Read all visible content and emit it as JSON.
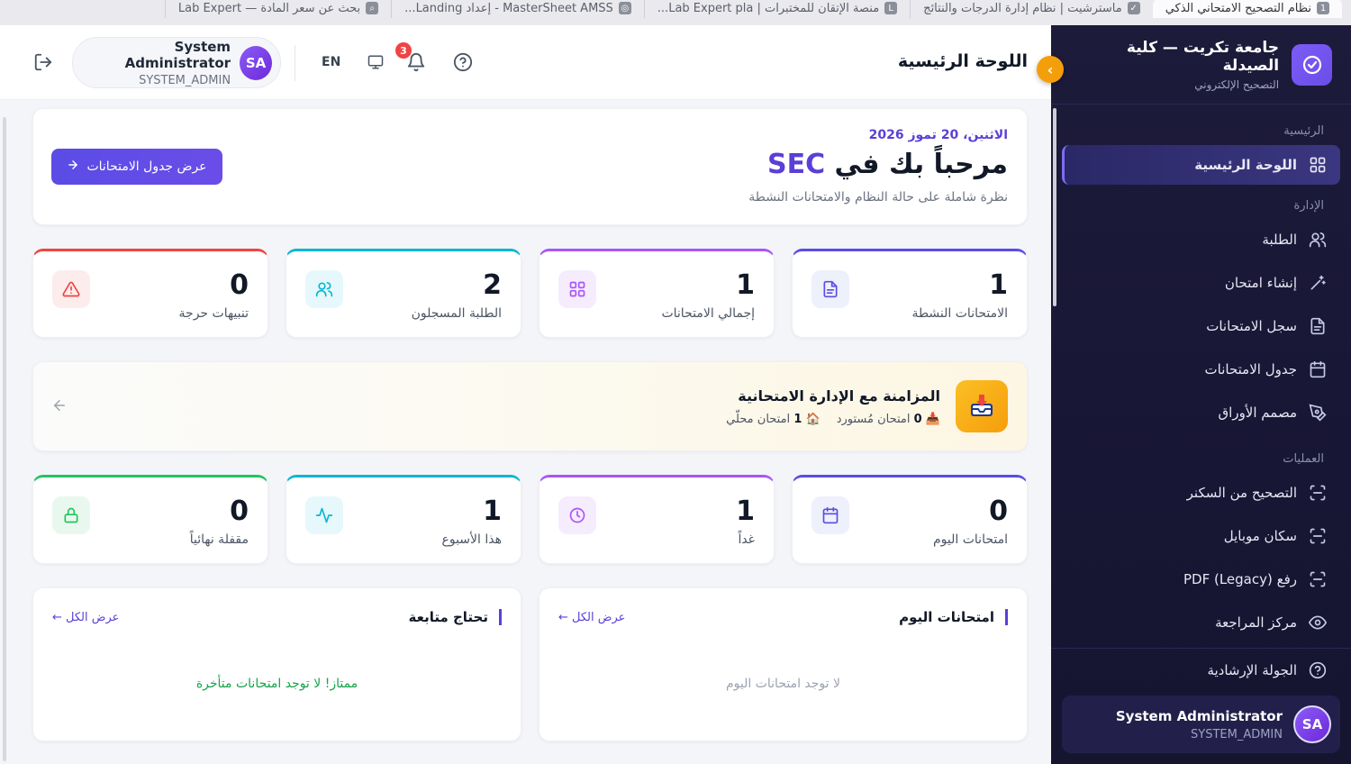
{
  "browser_tabs": [
    {
      "label": "نظام التصحيح الامتحاني الذكي",
      "fav": "1",
      "active": true
    },
    {
      "label": "ماسترشيت | نظام إدارة الدرجات والنتائج",
      "fav": "✓"
    },
    {
      "label": "منصة الإتقان للمختبرات | Lab Expert pla...",
      "fav": "L"
    },
    {
      "label": "MasterSheet AMSS - إعداد Landing...",
      "fav": "◎"
    },
    {
      "label": "بحث عن سعر المادة — Lab Expert",
      "fav": "⌕"
    }
  ],
  "sidebar": {
    "brand_title": "جامعة تكريت — كلية الصيدلة",
    "brand_sub": "التصحيح الإلكتروني",
    "sections": {
      "main": "الرئيسية",
      "admin": "الإدارة",
      "ops": "العمليات"
    },
    "items": {
      "dashboard": "اللوحة الرئيسية",
      "students": "الطلبة",
      "create_exam": "إنشاء امتحان",
      "exam_log": "سجل الامتحانات",
      "exam_schedule": "جدول الامتحانات",
      "sheet_designer": "مصمم الأوراق",
      "scanner": "التصحيح من السكنر",
      "mobile_scan": "سكان موبايل",
      "pdf_upload": "رفع PDF (Legacy)",
      "review_center": "مركز المراجعة",
      "guided_tour": "الجولة الإرشادية"
    },
    "user": {
      "name": "System Administrator",
      "role": "SYSTEM_ADMIN",
      "initials": "SA"
    }
  },
  "header": {
    "title": "اللوحة الرئيسية",
    "lang": "EN",
    "notifications": "3",
    "user": {
      "name": "System Administrator",
      "role": "SYSTEM_ADMIN",
      "initials": "SA"
    }
  },
  "welcome": {
    "date": "الاثنين، 20 تموز 2026",
    "title_prefix": "مرحباً بك في ",
    "title_accent": "SEC",
    "subtitle": "نظرة شاملة على حالة النظام والامتحانات النشطة",
    "button": "عرض جدول الامتحانات"
  },
  "stats_row1": [
    {
      "value": "1",
      "label": "الامتحانات النشطة",
      "color": "#5b4ce6"
    },
    {
      "value": "1",
      "label": "إجمالي الامتحانات",
      "color": "#a855f7"
    },
    {
      "value": "2",
      "label": "الطلبة المسجلون",
      "color": "#06b6d4"
    },
    {
      "value": "0",
      "label": "تنبيهات حرجة",
      "color": "#ef4444"
    }
  ],
  "sync": {
    "title": "المزامنة مع الإدارة الامتحانية",
    "imported_count": "0",
    "imported_label": "امتحان مُستورد",
    "local_count": "1",
    "local_label": "امتحان محلّي"
  },
  "stats_row2": [
    {
      "value": "0",
      "label": "امتحانات اليوم",
      "color": "#5b4ce6"
    },
    {
      "value": "1",
      "label": "غداً",
      "color": "#a855f7"
    },
    {
      "value": "1",
      "label": "هذا الأسبوع",
      "color": "#06b6d4"
    },
    {
      "value": "0",
      "label": "مقفلة نهائياً",
      "color": "#22c55e"
    }
  ],
  "panels": {
    "today": {
      "title": "امتحانات اليوم",
      "link": "عرض الكل ←",
      "empty": "لا توجد امتحانات اليوم"
    },
    "followup": {
      "title": "تحتاج متابعة",
      "link": "عرض الكل ←",
      "empty": "ممتاز! لا توجد امتحانات متأخرة"
    }
  }
}
